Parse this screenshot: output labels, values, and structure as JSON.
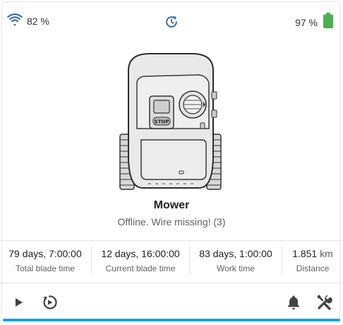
{
  "header": {
    "wifi_icon": "wifi-icon",
    "wifi_strength": "82 %",
    "refresh_icon": "refresh-icon",
    "battery_level": "97 %",
    "battery_icon": "battery-icon",
    "battery_color": "#4caf50"
  },
  "device": {
    "image_icon": "robot-mower-image",
    "name": "Mower",
    "status": "Offline. Wire missing! (3)"
  },
  "stats": [
    {
      "value": "79 days, 7:00:00",
      "label": "Total blade time"
    },
    {
      "value": "12 days, 16:00:00",
      "label": "Current blade time"
    },
    {
      "value": "83 days, 1:00:00",
      "label": "Work time"
    },
    {
      "value": "1.851",
      "unit": "km",
      "label": "Distance"
    }
  ],
  "actions": {
    "start_icon": "play-icon",
    "edge_cut_icon": "edge-cut-icon",
    "notifications_icon": "bell-icon",
    "settings_icon": "tools-icon"
  },
  "progress": {
    "fraction": 1.0,
    "color": "#18a2ee"
  },
  "colors": {
    "icon_blue": "#3d6fa8",
    "icon_gray": "#424242"
  }
}
